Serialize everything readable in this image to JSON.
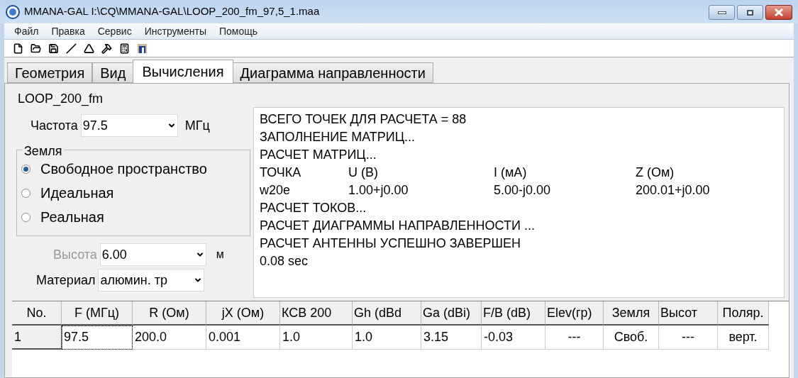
{
  "window": {
    "title": "MMANA-GAL I:\\CQ\\MMANA-GAL\\LOOP_200_fm_97,5_1.maa"
  },
  "menu": [
    "Файл",
    "Правка",
    "Сервис",
    "Инструменты",
    "Помощь"
  ],
  "tabs": [
    {
      "label": "Геометрия",
      "selected": false
    },
    {
      "label": "Вид",
      "selected": false
    },
    {
      "label": "Вычисления",
      "selected": true
    },
    {
      "label": "Диаграмма направленности",
      "selected": false
    }
  ],
  "project_name": "LOOP_200_fm",
  "frequency": {
    "label": "Частота",
    "value": "97.5",
    "unit": "МГц"
  },
  "ground": {
    "legend": "Земля",
    "options": [
      {
        "label": "Свободное пространство",
        "selected": true
      },
      {
        "label": "Идеальная",
        "selected": false
      },
      {
        "label": "Реальная",
        "selected": false
      }
    ]
  },
  "height": {
    "label": "Высота",
    "value": "6.00",
    "unit": "м",
    "disabled": true
  },
  "material": {
    "label": "Материал",
    "value": "алюмин. тр"
  },
  "log": [
    {
      "kind": "text",
      "text": "ВСЕГО ТОЧЕК ДЛЯ РАСЧЕТА = 88"
    },
    {
      "kind": "text",
      "text": "ЗАПОЛНЕНИЕ МАТРИЦ..."
    },
    {
      "kind": "text",
      "text": "РАСЧЕТ МАТРИЦ..."
    },
    {
      "kind": "row",
      "cells": [
        "ТОЧКА",
        "U (В)",
        "I (мА)",
        "Z (Ом)"
      ]
    },
    {
      "kind": "row",
      "cells": [
        "w20e",
        "1.00+j0.00",
        "5.00-j0.00",
        "200.01+j0.00"
      ]
    },
    {
      "kind": "text",
      "text": "РАСЧЕТ ТОКОВ..."
    },
    {
      "kind": "text",
      "text": "РАСЧЕТ ДИАГРАММЫ НАПРАВЛЕННОСТИ ..."
    },
    {
      "kind": "text",
      "text": "РАСЧЕТ АНТЕННЫ УСПЕШНО ЗАВЕРШЕН"
    },
    {
      "kind": "text",
      "text": "0.08 sec"
    }
  ],
  "table": {
    "columns": [
      "No.",
      "F (МГц)",
      "R (Ом)",
      "jX (Ом)",
      "КСВ 200",
      "Gh (dBd",
      "Ga (dBi)",
      "F/B (dB)",
      "Elev(гр)",
      "Земля",
      "Высот",
      "Поляр."
    ],
    "rows": [
      {
        "cells": [
          {
            "text": "1",
            "focused": false
          },
          {
            "text": "97.5",
            "focused": true
          },
          {
            "text": "200.0",
            "focused": false
          },
          {
            "text": "0.001",
            "focused": false
          },
          {
            "text": "1.0",
            "focused": false
          },
          {
            "text": "1.0",
            "focused": false
          },
          {
            "text": "3.15",
            "focused": false
          },
          {
            "text": "-0.03",
            "focused": false
          },
          {
            "text": "---",
            "focused": false
          },
          {
            "text": "Своб.",
            "focused": false
          },
          {
            "text": "---",
            "focused": false
          },
          {
            "text": "верт.",
            "focused": false
          }
        ]
      }
    ]
  }
}
